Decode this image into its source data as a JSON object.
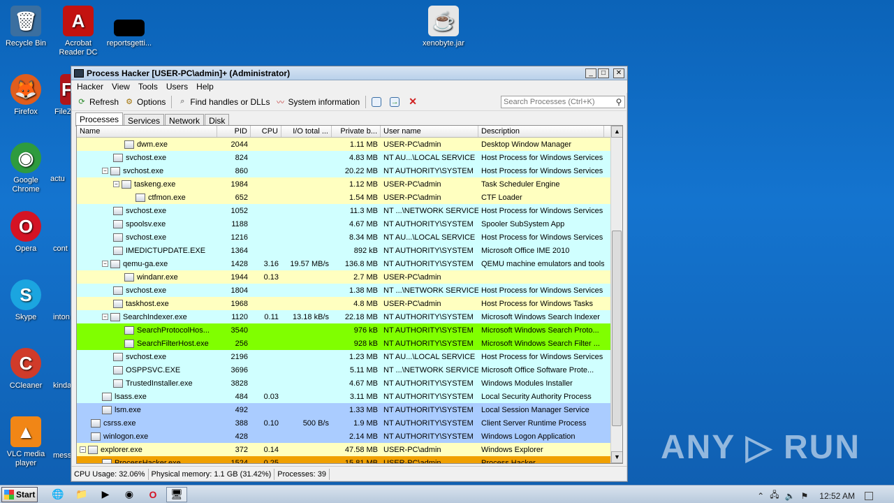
{
  "desktop": {
    "icons": [
      {
        "label": "Recycle Bin",
        "glyph": "🗑",
        "color": "#3b6fa0"
      },
      {
        "label": "Acrobat Reader DC",
        "glyph": "A",
        "color": "#c3120f"
      },
      {
        "label": "reportsgetti...",
        "glyph": "",
        "color": "#000000"
      },
      {
        "label": "xenobyte.jar",
        "glyph": "☕",
        "color": "#e6e6e6"
      },
      {
        "label": "Firefox",
        "glyph": "🦊",
        "color": "#e05d1d"
      },
      {
        "label": "FileZ",
        "glyph": "F",
        "color": "#b0151a"
      },
      {
        "label": "Google Chrome",
        "glyph": "◉",
        "color": "#2e9b3e"
      },
      {
        "label": "actu",
        "glyph": "",
        "color": "#1474cf"
      },
      {
        "label": "Opera",
        "glyph": "O",
        "color": "#d41324"
      },
      {
        "label": "cont",
        "glyph": "",
        "color": "#1474cf"
      },
      {
        "label": "Skype",
        "glyph": "S",
        "color": "#1ba5e0"
      },
      {
        "label": "inton",
        "glyph": "",
        "color": "#1474cf"
      },
      {
        "label": "CCleaner",
        "glyph": "C",
        "color": "#d03b2a"
      },
      {
        "label": "kinda",
        "glyph": "",
        "color": "#1474cf"
      },
      {
        "label": "VLC media player",
        "glyph": "▲",
        "color": "#f18616"
      },
      {
        "label": "mess",
        "glyph": "",
        "color": "#1474cf"
      }
    ],
    "watermark": "ANY ▷ RUN"
  },
  "window": {
    "title": "Process Hacker [USER-PC\\admin]+ (Administrator)",
    "buttons": {
      "minimize": "_",
      "maximize": "□",
      "close": "✕"
    },
    "menu": [
      "Hacker",
      "View",
      "Tools",
      "Users",
      "Help"
    ],
    "toolbar": {
      "refresh": "Refresh",
      "options": "Options",
      "find_handles": "Find handles or DLLs",
      "system_info": "System information"
    },
    "search_placeholder": "Search Processes (Ctrl+K)",
    "tabs": [
      "Processes",
      "Services",
      "Network",
      "Disk"
    ],
    "columns": [
      "Name",
      "PID",
      "CPU",
      "I/O total ...",
      "Private b...",
      "User name",
      "Description"
    ],
    "rows": [
      {
        "indent": 4,
        "exp": "",
        "name": "dwm.exe",
        "pid": "2044",
        "cpu": "",
        "io": "",
        "priv": "1.11 MB",
        "user": "USER-PC\\admin",
        "desc": "Desktop Window Manager",
        "color": "#ffffc0"
      },
      {
        "indent": 3,
        "exp": "",
        "name": "svchost.exe",
        "pid": "824",
        "cpu": "",
        "io": "",
        "priv": "4.83 MB",
        "user": "NT AU...\\LOCAL SERVICE",
        "desc": "Host Process for Windows Services",
        "color": "#d0ffff"
      },
      {
        "indent": 2,
        "exp": "−",
        "name": "svchost.exe",
        "pid": "860",
        "cpu": "",
        "io": "",
        "priv": "20.22 MB",
        "user": "NT AUTHORITY\\SYSTEM",
        "desc": "Host Process for Windows Services",
        "color": "#d0ffff"
      },
      {
        "indent": 3,
        "exp": "−",
        "name": "taskeng.exe",
        "pid": "1984",
        "cpu": "",
        "io": "",
        "priv": "1.12 MB",
        "user": "USER-PC\\admin",
        "desc": "Task Scheduler Engine",
        "color": "#ffffc0"
      },
      {
        "indent": 5,
        "exp": "",
        "name": "ctfmon.exe",
        "pid": "652",
        "cpu": "",
        "io": "",
        "priv": "1.54 MB",
        "user": "USER-PC\\admin",
        "desc": "CTF Loader",
        "color": "#ffffc0"
      },
      {
        "indent": 3,
        "exp": "",
        "name": "svchost.exe",
        "pid": "1052",
        "cpu": "",
        "io": "",
        "priv": "11.3 MB",
        "user": "NT ...\\NETWORK SERVICE",
        "desc": "Host Process for Windows Services",
        "color": "#d0ffff"
      },
      {
        "indent": 3,
        "exp": "",
        "name": "spoolsv.exe",
        "pid": "1188",
        "cpu": "",
        "io": "",
        "priv": "4.67 MB",
        "user": "NT AUTHORITY\\SYSTEM",
        "desc": "Spooler SubSystem App",
        "color": "#d0ffff"
      },
      {
        "indent": 3,
        "exp": "",
        "name": "svchost.exe",
        "pid": "1216",
        "cpu": "",
        "io": "",
        "priv": "8.34 MB",
        "user": "NT AU...\\LOCAL SERVICE",
        "desc": "Host Process for Windows Services",
        "color": "#d0ffff"
      },
      {
        "indent": 3,
        "exp": "",
        "name": "IMEDICTUPDATE.EXE",
        "pid": "1364",
        "cpu": "",
        "io": "",
        "priv": "892 kB",
        "user": "NT AUTHORITY\\SYSTEM",
        "desc": "Microsoft Office IME 2010",
        "color": "#d0ffff"
      },
      {
        "indent": 2,
        "exp": "−",
        "name": "qemu-ga.exe",
        "pid": "1428",
        "cpu": "3.16",
        "io": "19.57 MB/s",
        "priv": "136.8 MB",
        "user": "NT AUTHORITY\\SYSTEM",
        "desc": "QEMU machine emulators and tools",
        "color": "#d0ffff"
      },
      {
        "indent": 4,
        "exp": "",
        "name": "windanr.exe",
        "pid": "1944",
        "cpu": "0.13",
        "io": "",
        "priv": "2.7 MB",
        "user": "USER-PC\\admin",
        "desc": "",
        "color": "#ffffc0"
      },
      {
        "indent": 3,
        "exp": "",
        "name": "svchost.exe",
        "pid": "1804",
        "cpu": "",
        "io": "",
        "priv": "1.38 MB",
        "user": "NT ...\\NETWORK SERVICE",
        "desc": "Host Process for Windows Services",
        "color": "#d0ffff"
      },
      {
        "indent": 3,
        "exp": "",
        "name": "taskhost.exe",
        "pid": "1968",
        "cpu": "",
        "io": "",
        "priv": "4.8 MB",
        "user": "USER-PC\\admin",
        "desc": "Host Process for Windows Tasks",
        "color": "#ffffc0"
      },
      {
        "indent": 2,
        "exp": "−",
        "name": "SearchIndexer.exe",
        "pid": "1120",
        "cpu": "0.11",
        "io": "13.18 kB/s",
        "priv": "22.18 MB",
        "user": "NT AUTHORITY\\SYSTEM",
        "desc": "Microsoft Windows Search Indexer",
        "color": "#d0ffff"
      },
      {
        "indent": 4,
        "exp": "",
        "name": "SearchProtocolHos...",
        "pid": "3540",
        "cpu": "",
        "io": "",
        "priv": "976 kB",
        "user": "NT AUTHORITY\\SYSTEM",
        "desc": "Microsoft Windows Search Proto...",
        "color": "#80ff00"
      },
      {
        "indent": 4,
        "exp": "",
        "name": "SearchFilterHost.exe",
        "pid": "256",
        "cpu": "",
        "io": "",
        "priv": "928 kB",
        "user": "NT AUTHORITY\\SYSTEM",
        "desc": "Microsoft Windows Search Filter ...",
        "color": "#80ff00"
      },
      {
        "indent": 3,
        "exp": "",
        "name": "svchost.exe",
        "pid": "2196",
        "cpu": "",
        "io": "",
        "priv": "1.23 MB",
        "user": "NT AU...\\LOCAL SERVICE",
        "desc": "Host Process for Windows Services",
        "color": "#d0ffff"
      },
      {
        "indent": 3,
        "exp": "",
        "name": "OSPPSVC.EXE",
        "pid": "3696",
        "cpu": "",
        "io": "",
        "priv": "5.11 MB",
        "user": "NT ...\\NETWORK SERVICE",
        "desc": "Microsoft Office Software Prote...",
        "color": "#d0ffff"
      },
      {
        "indent": 3,
        "exp": "",
        "name": "TrustedInstaller.exe",
        "pid": "3828",
        "cpu": "",
        "io": "",
        "priv": "4.67 MB",
        "user": "NT AUTHORITY\\SYSTEM",
        "desc": "Windows Modules Installer",
        "color": "#d0ffff"
      },
      {
        "indent": 2,
        "exp": "",
        "name": "lsass.exe",
        "pid": "484",
        "cpu": "0.03",
        "io": "",
        "priv": "3.11 MB",
        "user": "NT AUTHORITY\\SYSTEM",
        "desc": "Local Security Authority Process",
        "color": "#d0ffff"
      },
      {
        "indent": 2,
        "exp": "",
        "name": "lsm.exe",
        "pid": "492",
        "cpu": "",
        "io": "",
        "priv": "1.33 MB",
        "user": "NT AUTHORITY\\SYSTEM",
        "desc": "Local Session Manager Service",
        "color": "#aaccff"
      },
      {
        "indent": 1,
        "exp": "",
        "name": "csrss.exe",
        "pid": "388",
        "cpu": "0.10",
        "io": "500 B/s",
        "priv": "1.9 MB",
        "user": "NT AUTHORITY\\SYSTEM",
        "desc": "Client Server Runtime Process",
        "color": "#aaccff"
      },
      {
        "indent": 1,
        "exp": "",
        "name": "winlogon.exe",
        "pid": "428",
        "cpu": "",
        "io": "",
        "priv": "2.14 MB",
        "user": "NT AUTHORITY\\SYSTEM",
        "desc": "Windows Logon Application",
        "color": "#aaccff"
      },
      {
        "indent": 0,
        "exp": "−",
        "name": "explorer.exe",
        "pid": "372",
        "cpu": "0.14",
        "io": "",
        "priv": "47.58 MB",
        "user": "USER-PC\\admin",
        "desc": "Windows Explorer",
        "color": "#ffffc0"
      },
      {
        "indent": 2,
        "exp": "",
        "name": "ProcessHacker.exe",
        "pid": "1524",
        "cpu": "0.25",
        "io": "",
        "priv": "15.81 MB",
        "user": "USER-PC\\admin",
        "desc": "Process Hacker",
        "color": "#f0a000"
      }
    ],
    "status": {
      "cpu": "CPU Usage: 32.06%",
      "memory": "Physical memory: 1.1 GB (31.42%)",
      "processes": "Processes: 39"
    }
  },
  "taskbar": {
    "start": "Start",
    "apps": [
      "🌐",
      "📁",
      "▶",
      "◉",
      "O",
      "🖥"
    ],
    "clock": "12:52 AM"
  }
}
